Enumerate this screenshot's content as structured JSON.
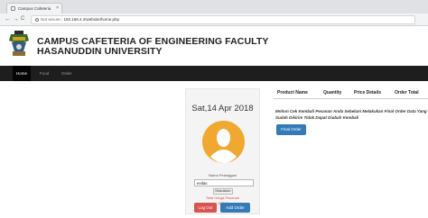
{
  "browser": {
    "tab_title": "Campus Cafeteria",
    "tab_close": "×",
    "back": "←",
    "forward": "→",
    "reload": "C",
    "security_text": "Not secure",
    "url": "192.168.4.2/website/home.php"
  },
  "header": {
    "title_line1": "CAMPUS CAFETERIA OF ENGINEERING FACULTY",
    "title_line2": "HASANUDDIN UNIVERSITY"
  },
  "nav": {
    "items": [
      {
        "label": "Home",
        "active": true
      },
      {
        "label": "Food",
        "active": false
      },
      {
        "label": "Order",
        "active": false
      }
    ]
  },
  "profile": {
    "date": "Sat,14 Apr 2018",
    "name_label": "Nama Pelanggan",
    "name_value": "evilas",
    "submit_label": "Masukkan",
    "total_label": "Total Harga Pesanan",
    "total_value": "IDR 0",
    "logout_label": "Log Out",
    "add_order_label": "Add Order"
  },
  "order": {
    "columns": [
      "Product Name",
      "Quantity",
      "Price Details",
      "Order Total"
    ],
    "warning": "Mohon Cek Kembali Pesanan Anda Sebelum Melakukan Final Order Data Yang Sudah Dikirim Tidak Dapat Diubah Kembali",
    "final_order_label": "Final Order"
  },
  "colors": {
    "navbar": "#1e1e1e",
    "primary": "#337ab7",
    "danger": "#d9534f",
    "avatar": "#f0a830"
  }
}
